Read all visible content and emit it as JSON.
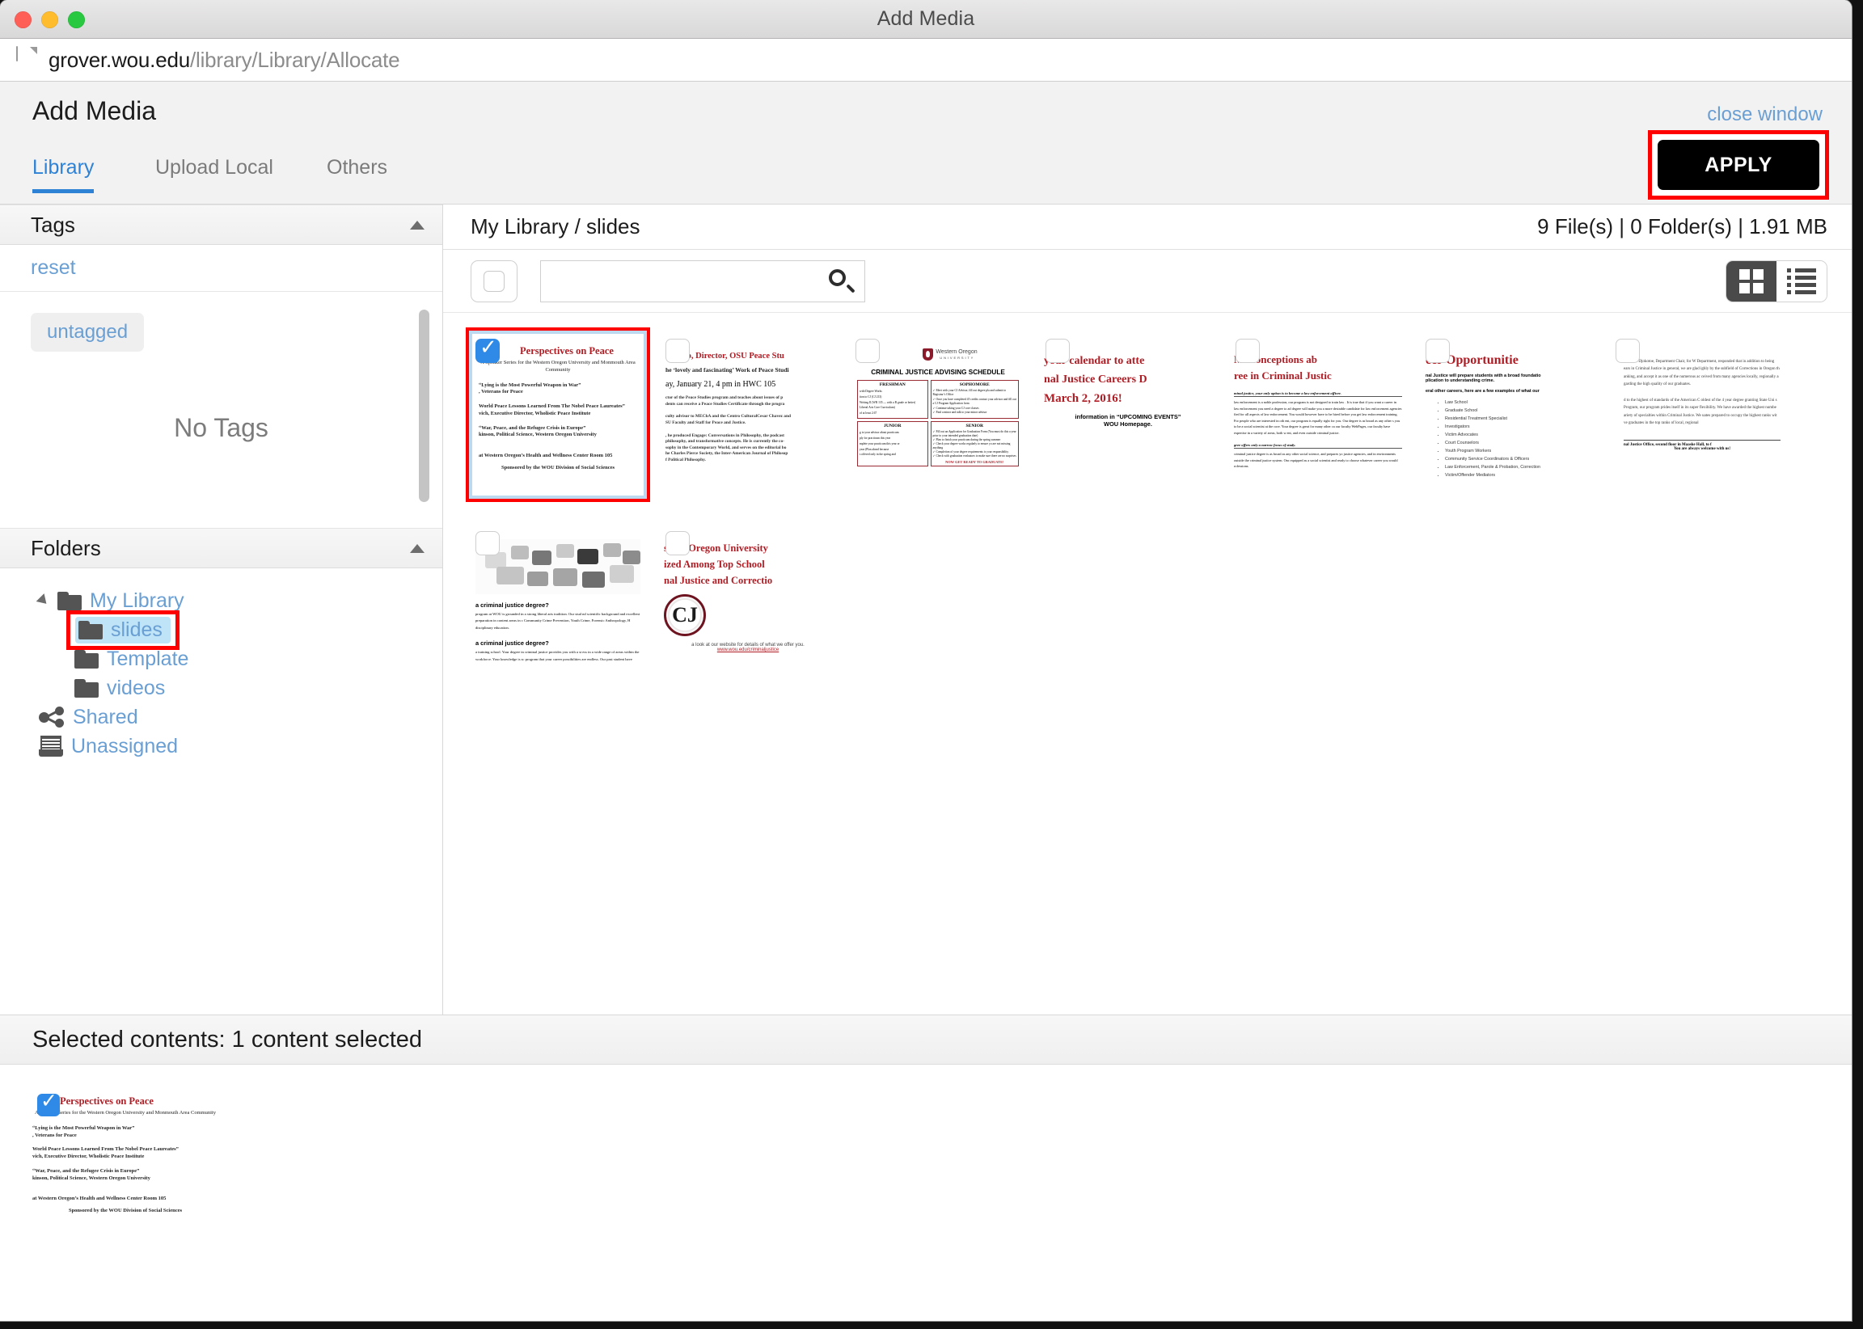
{
  "window": {
    "title": "Add Media",
    "traffic_lights": [
      "close-button",
      "minimize-button",
      "zoom-button"
    ]
  },
  "urlbar": {
    "host": "grover.wou.edu",
    "path": "/library/Library/Allocate",
    "icon": "page-document-icon"
  },
  "app_header": {
    "title": "Add Media",
    "close_window_label": "close window"
  },
  "tabs": [
    {
      "label": "Library",
      "active": true
    },
    {
      "label": "Upload Local",
      "active": false
    },
    {
      "label": "Others",
      "active": false
    }
  ],
  "apply": {
    "label": "APPLY",
    "highlight_color": "#ff0000",
    "background": "#000000"
  },
  "sidebar": {
    "tags": {
      "header": "Tags",
      "reset_label": "reset",
      "chip": "untagged",
      "empty_text": "No Tags"
    },
    "folders": {
      "header": "Folders",
      "tree": [
        {
          "label": "My Library",
          "icon": "folder-icon",
          "level": 0,
          "expanded": true
        },
        {
          "label": "slides",
          "icon": "folder-icon",
          "level": 1,
          "selected": true,
          "highlighted": true
        },
        {
          "label": "Template",
          "icon": "folder-icon",
          "level": 1
        },
        {
          "label": "videos",
          "icon": "folder-icon",
          "level": 1
        },
        {
          "label": "Shared",
          "icon": "share-icon",
          "level": 0
        },
        {
          "label": "Unassigned",
          "icon": "archive-icon",
          "level": 0
        }
      ]
    }
  },
  "main": {
    "breadcrumb": "My Library / slides",
    "file_stats": "9 File(s) | 0 Folder(s) | 1.91 MB",
    "search": {
      "value": "",
      "placeholder": "",
      "icon": "search-icon"
    },
    "select_all": {
      "checked": false
    },
    "view_toggle": {
      "grid_active": true,
      "list_active": false
    }
  },
  "thumbnails": [
    {
      "id": "perspectives-on-peace",
      "selected": true,
      "checked": true,
      "title": "Perspectives on Peace",
      "subtitle": "A Speaker Series for the Western Oregon University and Monmouth Area Community",
      "lines": [
        "“Lying is the Most Powerful Weapon in War”",
        ", Veterans for Peace",
        "World Peace Lessons Learned From The Nobel Peace Laureates”",
        "vich, Executive Director, Wholistic Peace Institute",
        "“War, Peace, and the Refugee Crisis in Europe”",
        "kinson, Political Science, Western Oregon University"
      ],
      "footer_red": "at Western Oregon’s Health and Wellness Center Room 105",
      "footer": "Sponsored by the WOU Division of Social Sciences"
    },
    {
      "id": "orosco-osu-peace-studies",
      "checked": false,
      "title": "Orosco, Director, OSU Peace Stu",
      "lines": [
        "he ‘lovely and fascinating’ Work of Peace Studi",
        "ay, January 21,  4 pm in HWC  105",
        "ctor of the Peace Studies program and teaches about issues of p",
        "dents can receive a Peace Studies Certificate through the progra",
        "culty advisor to MEChA and the Centro CulturalCesar Chavez and",
        "SU Faculty and Staff for Peace and Justice.",
        ", he produced Engage: Conversations in Philosophy, the podcast",
        "philosophy, and transformative concepts.  He is currently the co-",
        "sophy in the Contemporary World, and serves on the editorial bo",
        "he Charles Pierce Society, the Inter-American Journal of Philosop",
        "f Political Philosophy."
      ]
    },
    {
      "id": "cj-advising-schedule",
      "checked": false,
      "logo": "wou-logo",
      "logo_text_1": "Western Oregon",
      "logo_text_2": "U N I V E R S I T Y",
      "title": "CRIMINAL JUSTICE ADVISING SCHEDULE",
      "quadrants": [
        {
          "heading": "FRESHMAN",
          "items": [
            "with Degree Works",
            "tion to CJ (CJ 213)",
            "Writing II (WR 135 — with a B grade or better)",
            "Liberal Arts Core Curriculum)",
            "of at least 2.67"
          ]
        },
        {
          "heading": "SOPHOMORE",
          "items": [
            "Meet with your CJ Advisor, fill out degree pla and submit to Registrar’s Office",
            "Once you have completed 45 credits contact your advisor and fill out a CJ Program Application form",
            "Continue taking your CJ core classes",
            "Find a minor and talk to your minor advisor"
          ]
        },
        {
          "heading": "JUNIOR",
          "items": [
            "g to your advisor about practicum",
            "ply for practicum this year",
            "mplete your practicum this year or",
            "year  (Plan ahead because",
            "s offered only in the spring and"
          ]
        },
        {
          "heading": "SENIOR",
          "items": [
            "Fill out an Application for Graduation Form (You must do this a year prior to your intended graduation date)",
            "Plan to finish your practicum during the spring summer",
            "Check your degree works regularly to ensure yo are not missing anything",
            "Completion of your degree requirements is your responsibility",
            "Check with graduation evaluators to make sure there are no surprises"
          ]
        }
      ],
      "footer_red": "NOW GET READY TO GRADUATE!"
    },
    {
      "id": "cj-careers-day",
      "checked": false,
      "lines_red": [
        "your calendar to atte",
        "nal Justice Careers D",
        "March 2, 2016!"
      ],
      "lines": [
        "information in “UPCOMING EVENTS”",
        "WOU Homepage."
      ]
    },
    {
      "id": "misconceptions-cj-degree",
      "checked": false,
      "title_red_1": "Misconceptions ab",
      "title_red_2": "ree in Criminal Justic",
      "sub_italic_1": "minal justice, your only option is to become a law enforcement officer.",
      "body_1": "law enforcement is a noble profession, our program is not designed to train law . It is true that if you want a career in law enforcement you need a degree to ad degree will make you a more desirable candidate for law enforcement agencies fied for all aspects of law enforcement. You would however have to be hired before you get law enforcement training. For people who are interested in oth ent, our program is equally right for you. Our degree is as broad as any other s you to be a social scientist at the core. Your degree is great for many other ca our faculty WebPages, our faculty have expertise in a variety of areas, both w ent, and even outside criminal justice.",
      "sub_italic_2": "gree offers only a narrow focus of study.",
      "body_2": "criminal justice degree is as broad as any other social science, and prepares yo justice agencies, and in environments outside the criminal justice system. Onc equipped as a social scientist and ready to choose whatever career you would rofessions."
    },
    {
      "id": "career-opportunities",
      "checked": false,
      "title_red": "eer Opportunitie",
      "lines": [
        "nal Justice will prepare students with a broad foundatio",
        "plication to understanding crime.",
        "eral other careers, here are a few examples of what our"
      ],
      "bullets": [
        "Law School",
        "Graduate School",
        "Residential Treatment Specialist",
        "Investigators",
        "Victim Advocates",
        "Court Counselors",
        "Youth Program Workers",
        "Community Service Coordinators & Officers",
        "Law Enforcement, Parole & Probation, Correction",
        "Victim/Offender Mediators"
      ]
    },
    {
      "id": "djokotoe-department-chair",
      "checked": false,
      "para_1": "r. Vivian Djokotoe, Department Chair, for W Department, responded that in addition to being ears in Criminal Justice in general, we are  glad ighly by the subfield of Corrections in Oregon th anking, and accept it as one of the numerous ac ceived from many agencies locally, regionally a garding the high quality of our graduates.",
      "para_2": "d to the highest of standards of the American C oldest of the 4 year degree granting State Uni s Program, our program prides itself in its super flexibility. We have awarded the highest numbe ariety of specialties within Criminal Justice. We uates prepared to occupy the highest ranks wit ve graduates in the top ranks of local, regional",
      "footer_1": "nal Justice Office, second floor in Maaske Hall, to f",
      "footer_2": "You are always welcome with us!"
    },
    {
      "id": "what-is-cj-degree",
      "checked": false,
      "image": "puzzle-pieces-image",
      "q1": "a criminal justice degree?",
      "a1": "program at WOU is grounded in a strong liberal arts tradition. Our stud nd scientific background and excellent preparation in content areas in c Community Crime Prevention, Youth Crime, Forensic Anthropology, H disciplinary education.",
      "q2": "a criminal justice degree?",
      "a2": "a training school. Your degree in criminal justice provides you with a st ess in a wide range of areas within the workforce. Your knowledge is sc program that your career possibilities are endless. Our past student have"
    },
    {
      "id": "wou-top-schools",
      "checked": false,
      "title_red_1": "stern Oregon University",
      "title_red_2": "ized Among Top School",
      "title_red_3": "nal Justice and Correctio",
      "seal": "cj-seal-logo",
      "footer_1": "a look at our website for details of what we offer you.",
      "footer_link": "www.wou.edu/criminaljustice"
    }
  ],
  "selected_panel": {
    "header": "Selected contents: 1 content selected",
    "item": {
      "title": "Perspectives on Peace",
      "subtitle": "A Speaker Series for the Western Oregon University and Monmouth Area Community",
      "lines": [
        "“Lying is the Most Powerful Weapon in War”",
        ", Veterans for Peace",
        "World Peace Lessons Learned From The Nobel Peace Laureates”",
        "vich, Executive Director, Wholistic Peace Institute",
        "“War, Peace, and the Refugee Crisis in Europe”",
        "kinson, Political Science, Western Oregon University"
      ],
      "footer_red": "at Western Oregon’s Health and Wellness Center Room 105",
      "footer": "Sponsored by the WOU Division of Social Sciences"
    }
  }
}
